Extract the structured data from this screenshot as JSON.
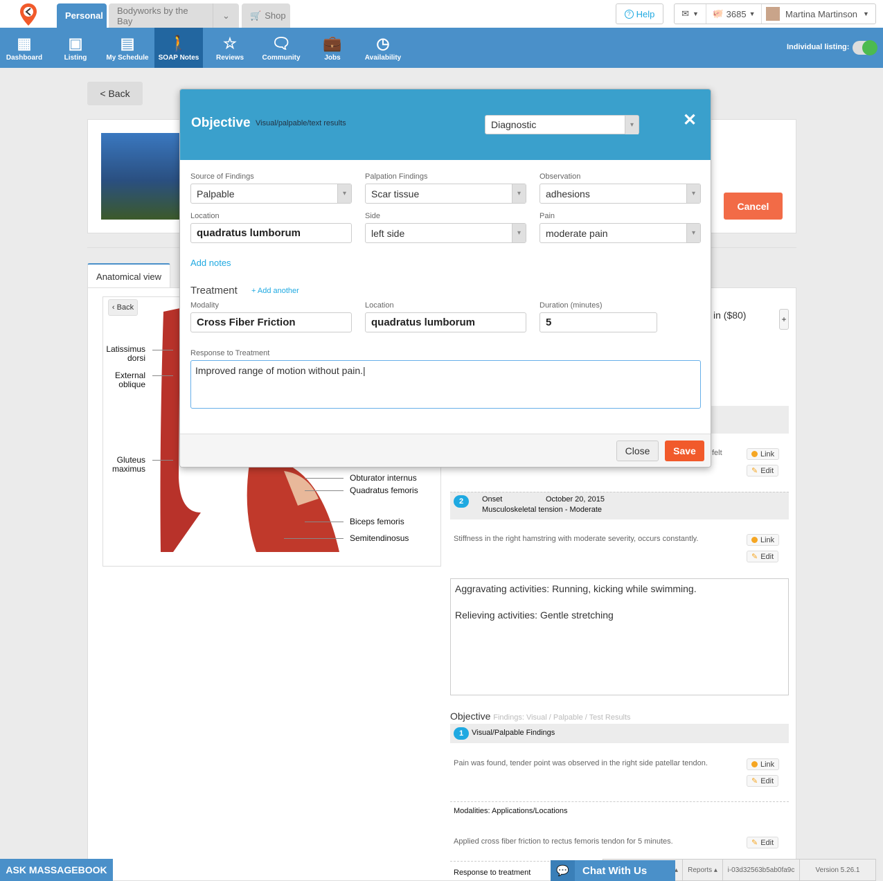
{
  "header": {
    "tabs": [
      "Personal",
      "Bodyworks by the Bay",
      "Shop"
    ],
    "help": "Help",
    "points": "3685",
    "user": "Martina Martinson"
  },
  "nav": {
    "items": [
      "Dashboard",
      "Listing",
      "My Schedule",
      "SOAP Notes",
      "Reviews",
      "Community",
      "Jobs",
      "Availability"
    ],
    "active": "SOAP Notes",
    "listing_label": "Individual listing:",
    "listing_on": true
  },
  "page": {
    "back": "< Back",
    "cancel": "Cancel",
    "tab": "Anatomical view",
    "anat_back": "‹ Back",
    "anatomy_labels_left": [
      "Latissimus\ndorsi",
      "External\noblique",
      "Gluteus\nmaximus"
    ],
    "anatomy_labels_right": [
      "Obturator internus",
      "Quadratus femoris",
      "Biceps femoris",
      "Semitendinosus"
    ]
  },
  "right": {
    "service": "in ($80)",
    "plus": "+",
    "felt": "felt",
    "link": "Link",
    "edit": "Edit",
    "item2": {
      "num": "2",
      "onset_label": "Onset",
      "onset_date": "October 20, 2015",
      "desc": "Musculoskeletal tension - Moderate",
      "text": "Stiffness in the right hamstring with moderate severity, occurs constantly."
    },
    "activities": {
      "aggravating": "Aggravating activities: Running, kicking while swimming.",
      "relieving": "Relieving activities: Gentle stretching"
    },
    "objective": {
      "title": "Objective",
      "subtitle": "Findings: Visual / Palpable / Test Results",
      "item_num": "1",
      "item": "Visual/Palpable Findings",
      "text": "Pain was found, tender point was observed in the right side patellar tendon."
    },
    "modalities": {
      "title": "Modalities: Applications/Locations",
      "text": "Applied cross fiber friction to rectus femoris tendon for 5 minutes."
    },
    "response": "Response to treatment"
  },
  "modal": {
    "title": "Objective",
    "subtitle": "Visual/palpable/text results",
    "type": "Diagnostic",
    "source_label": "Source of Findings",
    "source": "Palpable",
    "palpation_label": "Palpation Findings",
    "palpation": "Scar tissue",
    "observation_label": "Observation",
    "observation": "adhesions",
    "location_label": "Location",
    "location": "quadratus lumborum",
    "side_label": "Side",
    "side": "left side",
    "pain_label": "Pain",
    "pain": "moderate pain",
    "add_notes": "Add notes",
    "treatment": "Treatment",
    "add_another": "+ Add another",
    "modality_label": "Modality",
    "modality": "Cross Fiber Friction",
    "t_location_label": "Location",
    "t_location": "quadratus lumborum",
    "duration_label": "Duration (minutes)",
    "duration": "5",
    "response_label": "Response to Treatment",
    "response": "Improved range of motion without pain.",
    "close": "Close",
    "save": "Save"
  },
  "footer": {
    "ask": "ASK MASSAGEBOOK",
    "chat": "Chat With Us",
    "reports": "Reports ▴",
    "instance": "i-03d32563b5ab0fa9c",
    "version": "Version 5.26.1"
  },
  "colors": {
    "nav": "#4a90c9",
    "nav_active": "#2266a0",
    "modal_header": "#3aa0cc",
    "save": "#f15a2b",
    "accent": "#1fa9e1"
  }
}
